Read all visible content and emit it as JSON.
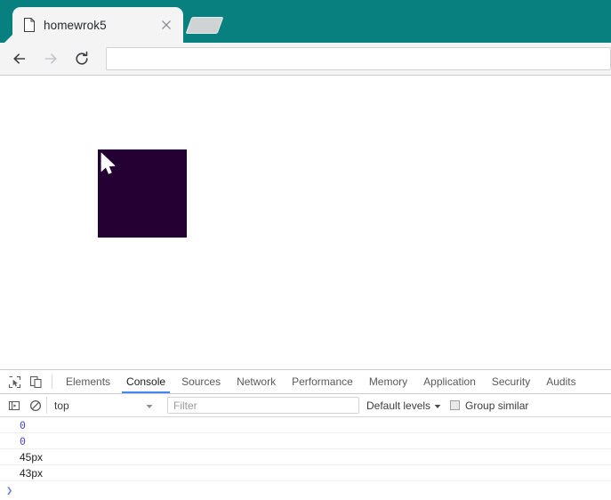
{
  "browser": {
    "chrome_color": "#088080",
    "tab": {
      "title": "homewrok5",
      "favicon": "page-icon",
      "close": "close-icon"
    },
    "new_tab_label": "",
    "toolbar": {
      "back": "back-arrow-icon",
      "forward": "forward-arrow-icon",
      "reload": "reload-icon",
      "address_value": "",
      "address_placeholder": ""
    }
  },
  "page": {
    "box_color": "#240033",
    "cursor": "mouse-pointer-icon"
  },
  "devtools": {
    "toolbar_icons": {
      "inspect": "inspect-element-icon",
      "device": "device-toolbar-icon",
      "sidebar": "console-sidebar-icon",
      "clear": "clear-console-icon"
    },
    "tabs": [
      {
        "label": "Elements",
        "active": false
      },
      {
        "label": "Console",
        "active": true
      },
      {
        "label": "Sources",
        "active": false
      },
      {
        "label": "Network",
        "active": false
      },
      {
        "label": "Performance",
        "active": false
      },
      {
        "label": "Memory",
        "active": false
      },
      {
        "label": "Application",
        "active": false
      },
      {
        "label": "Security",
        "active": false
      },
      {
        "label": "Audits",
        "active": false
      }
    ],
    "filterbar": {
      "context_value": "top",
      "filter_placeholder": "Filter",
      "filter_value": "",
      "levels_label": "Default levels",
      "group_similar_label": "Group similar",
      "group_similar_checked": false,
      "caret": "chevron-down-icon"
    },
    "console_rows": [
      {
        "text": "0",
        "type": "number"
      },
      {
        "text": "0",
        "type": "number"
      },
      {
        "text": "45px",
        "type": "string"
      },
      {
        "text": "43px",
        "type": "string"
      }
    ],
    "prompt_symbol": "❯"
  }
}
